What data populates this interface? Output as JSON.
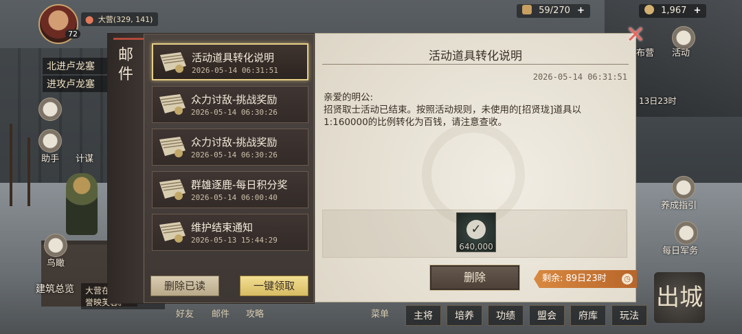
{
  "topbar": {
    "level": "72",
    "location_label": "大营(329, 141)",
    "resource1": "59/270",
    "resource2": "1,967"
  },
  "hud": {
    "quest_line1": "北进卢龙塞",
    "quest_line2": "进攻卢龙塞",
    "right_label1": "布营",
    "right_label2": "活动",
    "right_timer": "13日23时",
    "left_label1": "助手",
    "left_label2": "计谋",
    "left_label3": "鸟瞰",
    "right_label3": "养成指引",
    "right_label4": "每日军务",
    "building_overview": "建筑总览",
    "chat_snippet": "大营在 获得 门, 伏誉映芙蓉。",
    "bottom_mini": [
      "好友",
      "邮件",
      "攻略",
      "菜单"
    ],
    "bottom_nav": [
      "主将",
      "培养",
      "功绩",
      "盟会",
      "府库",
      "玩法"
    ],
    "chucheng": "出城"
  },
  "mail": {
    "sidebar_title": "邮件",
    "items": [
      {
        "title": "活动道具转化说明",
        "time": "2026-05-14 06:31:51",
        "selected": true
      },
      {
        "title": "众力讨敌-挑战奖励",
        "time": "2026-05-14 06:30:26"
      },
      {
        "title": "众力讨敌-挑战奖励",
        "time": "2026-05-14 06:30:26"
      },
      {
        "title": "群雄逐鹿-每日积分奖",
        "time": "2026-05-14 06:00:40"
      },
      {
        "title": "维护结束通知",
        "time": "2026-05-13 15:44:29"
      }
    ],
    "delete_read": "删除已读",
    "claim_all": "一键领取",
    "detail": {
      "title": "活动道具转化说明",
      "date": "2026-05-14 06:31:51",
      "greeting": "亲爱的明公:",
      "body": "招贤取士活动已结束。按照活动规则，未使用的[招贤珑]道具以1:160000的比例转化为百钱，请注意查收。",
      "attachment_qty": "640,000",
      "delete_label": "删除",
      "remaining": "剩余: 89日23时"
    }
  },
  "colors": {
    "selected_border": "#e6cf86",
    "remain_bg": "#d88940",
    "close": "#e46a62"
  }
}
